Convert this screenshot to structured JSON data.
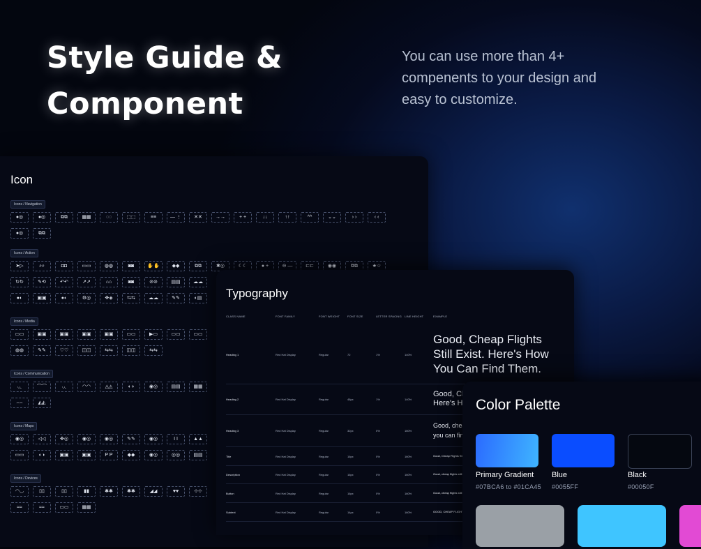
{
  "hero": {
    "title_line1": "Style Guide &",
    "title_line2": "Component",
    "subtitle_line1": "You can use more than 4+",
    "subtitle_line2": "compenents to your design and",
    "subtitle_line3": "easy to customize."
  },
  "icon_panel": {
    "title": "Icon",
    "groups": [
      {
        "label": "Icons / Navigation",
        "rows": [
          [
            "●◎",
            "●◎",
            "⧉⧉",
            "▦▦",
            "◌◌",
            "⬚⬚",
            "≡≡",
            "— ⋮",
            "✕✕",
            "→→",
            "+ +",
            "↓↓",
            "↑↑",
            "^^",
            "⌄⌄",
            "›  ›",
            "‹  ‹"
          ],
          [
            "●◎",
            "⧉⧉"
          ]
        ]
      },
      {
        "label": "Icons / Action",
        "rows": [
          [
            "➤▷",
            "⌕⌕",
            "◘◘",
            "▭▭",
            "◍◍",
            "◙◙",
            "✋✋",
            "◆◆",
            "⧉⧉",
            "✱◎",
            "☾☾",
            "● +",
            "⊖ —",
            "⊏⊏",
            "◉◉",
            "⧉⧉",
            "★☆"
          ],
          [
            "↻↻",
            "✎⟲",
            "↶↶",
            "↗↗",
            "⌂⌂",
            "◙◙",
            "⊘⊘",
            "▤▤",
            "☁☁"
          ],
          [
            "●◐",
            "▣▣",
            "●◐",
            "⚙◎",
            "✥◈",
            "⇆⇆",
            "☁☁",
            "✎✎",
            "◐▤"
          ]
        ]
      },
      {
        "label": "Icons / Media",
        "rows": [
          [
            "▭▭",
            "▣▣",
            "▣▣",
            "▣▣",
            "▣▣",
            "▭▭",
            "▶▭",
            "▭▭",
            "▭▭"
          ],
          [
            "◍◍",
            "✎✎",
            "♡♡",
            "◫◫",
            "⇆⇆",
            "◫◫",
            "⇆⇆"
          ]
        ]
      },
      {
        "label": "Icons / Communication",
        "rows": [
          [
            "◟◟",
            "⌒⌒",
            "◟◟",
            "◠◠",
            "◬◬",
            "◐◑",
            "◉◎",
            "▤▤",
            "▦▦"
          ],
          [
            "⌢⌢",
            "◭◭"
          ]
        ]
      },
      {
        "label": "Icons / Maps",
        "rows": [
          [
            "◉◎",
            "◁◁",
            "✥◎",
            "◉◎",
            "◉◎",
            "✎✎",
            "◉◎",
            "I I",
            "▲▲"
          ],
          [
            "▭▭",
            "◐◑",
            "▣▣",
            "▣▣",
            "P P",
            "◆◆",
            "◉◎",
            "◎◎",
            "▤▤"
          ]
        ]
      },
      {
        "label": "Icons / Devices",
        "rows": [
          [
            "◠◡",
            "▯▯",
            "▯▯",
            "▮▮",
            "✱✱",
            "✱✱",
            "◢◢",
            "♥♥",
            "⊹⊹"
          ],
          [
            "≈≈",
            "≈≈",
            "▭▭",
            "▦▦"
          ]
        ]
      }
    ]
  },
  "typography": {
    "title": "Typography",
    "headers": [
      "CLASS NAME",
      "FONT FAMILY",
      "FONT WEIGHT",
      "FONT SIZE",
      "LETTER SPACING",
      "LINE HEIGHT",
      "EXAMPLE"
    ],
    "rows": [
      {
        "name": "Heading 1",
        "family": "Red Hat Display",
        "weight": "Regular",
        "size": "72",
        "spacing": "1%",
        "height": "140%",
        "example": [
          "Good, Cheap Flights",
          "Still Exist. Here's How",
          "You Can Find Them."
        ]
      },
      {
        "name": "Heading 2",
        "family": "Red Hat Display",
        "weight": "Regular",
        "size": "48px",
        "spacing": "1%",
        "height": "140%",
        "example": [
          "Good, Cheap Flights",
          "Here's How You Can"
        ]
      },
      {
        "name": "Heading 3",
        "family": "Red Hat Display",
        "weight": "Regular",
        "size": "32px",
        "spacing": "0%",
        "height": "160%",
        "example": [
          "Good, cheap flights",
          "you can find them."
        ]
      },
      {
        "name": "Title",
        "family": "Red Hat Display",
        "weight": "Regular",
        "size": "16px",
        "spacing": "0%",
        "height": "160%",
        "example": [
          "Good, Cheap Flights Still Exist"
        ]
      },
      {
        "name": "Description",
        "family": "Red Hat Display",
        "weight": "Regular",
        "size": "16px",
        "spacing": "0%",
        "height": "160%",
        "example": [
          "Good, cheap flights still exist"
        ]
      },
      {
        "name": "Button",
        "family": "Red Hat Display",
        "weight": "Regular",
        "size": "16px",
        "spacing": "0%",
        "height": "160%",
        "example": [
          "Good, cheap flights still exist"
        ]
      },
      {
        "name": "Subtext",
        "family": "Red Hat Display",
        "weight": "Regular",
        "size": "14px",
        "spacing": "0%",
        "height": "160%",
        "example": [
          "GOOD, CHEAP FLIGHTS STILL"
        ]
      }
    ]
  },
  "color_palette": {
    "title": "Color Palette",
    "swatches": [
      {
        "name": "Primary Gradient",
        "hex": "#07BCA6 to #01CA45"
      },
      {
        "name": "Blue",
        "hex": "#0055FF"
      },
      {
        "name": "Black",
        "hex": "#00050F"
      }
    ],
    "colors": {
      "primary_gradient_start": "#2b6bff",
      "primary_gradient_end": "#3fb5ff",
      "blue": "#0a4dff",
      "black": "#050810",
      "gray": "#9aa0a6",
      "cyan": "#3fc5ff",
      "pink": "#e24ad4"
    }
  }
}
